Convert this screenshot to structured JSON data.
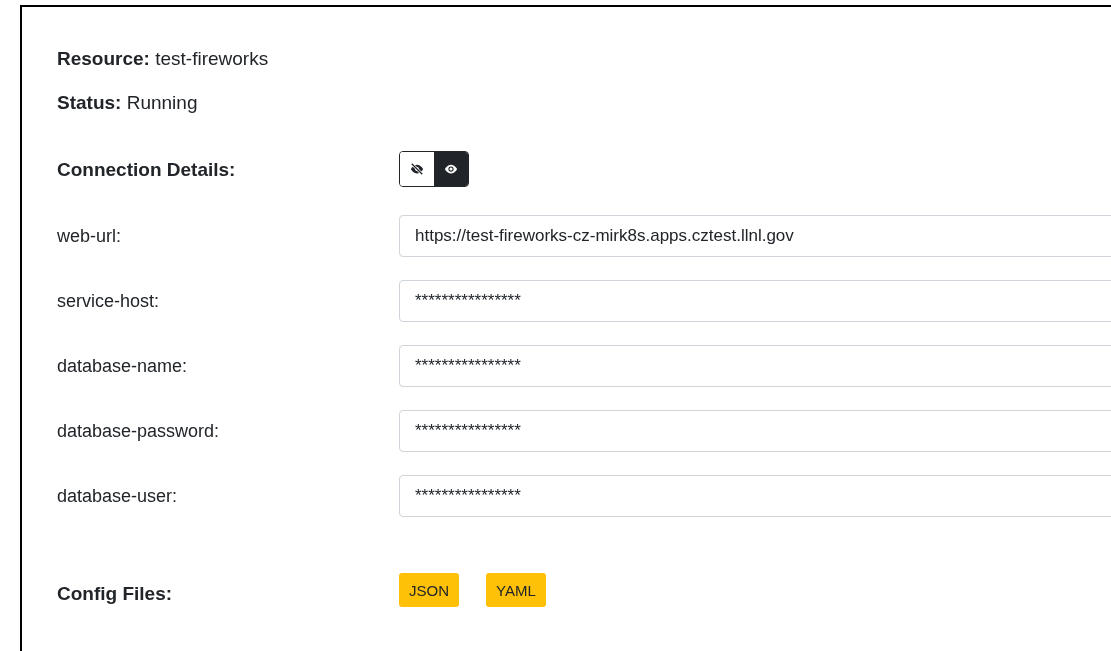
{
  "resource": {
    "label": "Resource:",
    "value": "test-fireworks"
  },
  "status": {
    "label": "Status:",
    "value": "Running"
  },
  "connection_details": {
    "label": "Connection Details:",
    "visibility_toggle": [
      {
        "kind": "hide",
        "selected": false
      },
      {
        "kind": "show",
        "selected": true
      }
    ],
    "fields": [
      {
        "label": "web-url:",
        "value": "https://test-fireworks-cz-mirk8s.apps.cztest.llnl.gov"
      },
      {
        "label": "service-host:",
        "value": "****************"
      },
      {
        "label": "database-name:",
        "value": "****************"
      },
      {
        "label": "database-password:",
        "value": "****************"
      },
      {
        "label": "database-user:",
        "value": "****************"
      }
    ]
  },
  "config_files": {
    "label": "Config Files:",
    "buttons": [
      "JSON",
      "YAML"
    ]
  }
}
